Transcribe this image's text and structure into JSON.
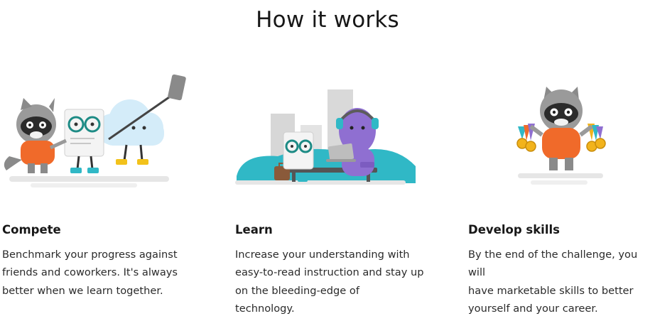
{
  "section": {
    "title": "How it works"
  },
  "cards": [
    {
      "title": "Compete",
      "text": "Benchmark your progress against\nfriends and coworkers. It's always\nbetter when we learn together.",
      "illustration": "selfie-mascots-illustration"
    },
    {
      "title": "Learn",
      "text": "Increase your understanding with\neasy-to-read instruction and stay up\non the bleeding-edge of\ntechnology.",
      "illustration": "bench-laptop-illustration"
    },
    {
      "title": "Develop skills",
      "text": "By the end of the challenge, you will\nhave marketable skills to better\nyourself and your career.",
      "illustration": "raccoon-medals-illustration"
    }
  ],
  "colors": {
    "text": "#171717",
    "orange": "#f06a2a",
    "teal": "#30b8c6",
    "purple": "#8f6fd1",
    "gold": "#f2b31c",
    "cloud": "#cfe9f8"
  }
}
